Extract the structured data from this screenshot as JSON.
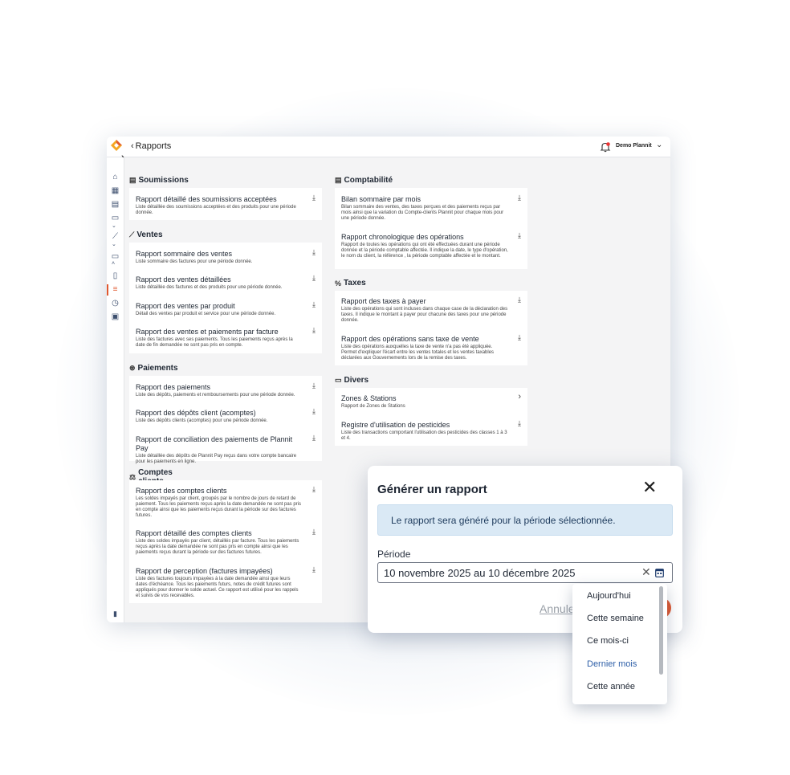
{
  "header": {
    "back_label": "Rapports",
    "user_name": "Demo Plannit"
  },
  "sections": {
    "soumissions": {
      "title": "Soumissions",
      "items": [
        {
          "title": "Rapport détaillé des soumissions acceptées",
          "desc": "Liste détaillée des soumissions acceptées et des produits pour une période donnée."
        }
      ]
    },
    "ventes": {
      "title": "Ventes",
      "items": [
        {
          "title": "Rapport sommaire des ventes",
          "desc": "Liste sommaire des factures pour une période donnée."
        },
        {
          "title": "Rapport des ventes détaillées",
          "desc": "Liste détaillée des factures et des produits pour une période donnée."
        },
        {
          "title": "Rapport des ventes par produit",
          "desc": "Détail des ventes par produit et service pour une période donnée."
        },
        {
          "title": "Rapport des ventes et paiements par facture",
          "desc": "Liste des factures avec ses paiements. Tous les paiements reçus après la date de fin demandée ne sont pas pris en compte."
        }
      ]
    },
    "paiements": {
      "title": "Paiements",
      "items": [
        {
          "title": "Rapport des paiements",
          "desc": "Liste des dépôts, paiements et remboursements pour une période donnée."
        },
        {
          "title": "Rapport des dépôts client (acomptes)",
          "desc": "Liste des dépôts clients (acomptes) pour une période donnée."
        },
        {
          "title": "Rapport de conciliation des paiements de Plannit Pay",
          "desc": "Liste détaillée des dépôts de Plannit Pay reçus dans votre compte bancaire pour les paiements en ligne."
        }
      ]
    },
    "comptes": {
      "title": "Comptes clients",
      "items": [
        {
          "title": "Rapport des comptes clients",
          "desc": "Les soldes impayés par client, groupés par le nombre de jours de retard de paiement. Tous les paiements reçus après la date demandée ne sont pas pris en compte ainsi que les paiements reçus durant la période sur des factures futures."
        },
        {
          "title": "Rapport détaillé des comptes clients",
          "desc": "Liste des soldes impayés par client, détaillés par facture. Tous les paiements reçus après la date demandée ne sont pas pris en compte ainsi que les paiements reçus durant la période sur des factures futures."
        },
        {
          "title": "Rapport de perception (factures impayées)",
          "desc": "Liste des factures toujours impayées à la date demandée ainsi que leurs dates d'échéance. Tous les paiements futurs, notes de crédit futures sont appliqués pour donner le solde actuel. Ce rapport est utilisé pour les rappels et suivis de vos recevables."
        }
      ]
    },
    "comptabilite": {
      "title": "Comptabilité",
      "items": [
        {
          "title": "Bilan sommaire par mois",
          "desc": "Bilan sommaire des ventes, des taxes perçues et des paiements reçus par mois ainsi que la variation du Compte-clients Plannit pour chaque mois pour une période donnée."
        },
        {
          "title": "Rapport chronologique des opérations",
          "desc": "Rapport de toutes les opérations qui ont été effectuées durant une période donnée et la période comptable affectée. Il indique la date, le type d'opération, le nom du client, la référence , la période comptable affectée et le montant."
        }
      ]
    },
    "taxes": {
      "title": "Taxes",
      "items": [
        {
          "title": "Rapport des taxes à payer",
          "desc": "Liste des opérations qui sont incluses dans chaque case de la déclaration des taxes. Il indique le montant à payer pour chacune des taxes pour une période donnée."
        },
        {
          "title": "Rapport des opérations sans taxe de vente",
          "desc": "Liste des opérations auxquelles la taxe de vente n'a pas été appliquée. Permet d'expliquer l'écart entre les ventes totales et les ventes taxables déclarées aux Gouvernements lors de la remise des taxes."
        }
      ]
    },
    "divers": {
      "title": "Divers",
      "items": [
        {
          "title": "Zones & Stations",
          "desc": "Rapport de Zones de Stations"
        },
        {
          "title": "Registre d'utilisation de pesticides",
          "desc": "Liste des transactions comportant l'utilisation des pesticides des classes 1 à 3 et 4."
        }
      ]
    }
  },
  "modal": {
    "title": "Générer un rapport",
    "info": "Le rapport sera généré pour la période sélectionnée.",
    "period_label": "Période",
    "period_value": "10 novembre 2025 au 10 décembre 2025",
    "cancel_label": "Annule"
  },
  "dropdown": {
    "options": [
      "Aujourd'hui",
      "Cette semaine",
      "Ce mois-ci",
      "Dernier mois",
      "Cette année"
    ],
    "selected": "Dernier mois"
  },
  "colors": {
    "accent": "#e1582f",
    "info_bg": "#dae9f5",
    "selected_option": "#2e5fa8"
  }
}
